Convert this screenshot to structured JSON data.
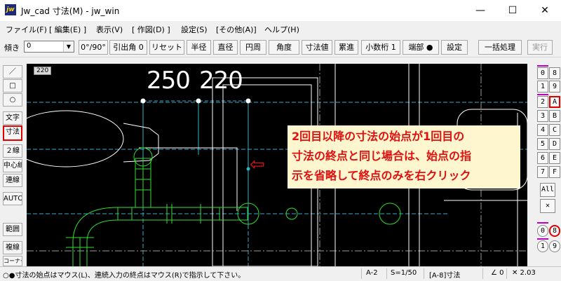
{
  "window": {
    "title": "Jw_cad 寸法(M) - jw_win",
    "icon_label": "jw",
    "controls": {
      "minimize": "—",
      "maximize": "☐",
      "close": "✕"
    }
  },
  "menu": [
    "ファイル(F)",
    "[ 編集(E) ]",
    "表示(V)",
    "[ 作図(D) ]",
    "設定(S)",
    "[その他(A)]",
    "ヘルプ(H)"
  ],
  "toolbar": {
    "angle_label": "傾き",
    "angle_value": "0",
    "buttons": [
      "0°/90°",
      "引出角 0",
      "リセット",
      "半径",
      "直径",
      "円周",
      "角度",
      "寸法値",
      "累進",
      "小数桁 1",
      "端部 ●",
      "設定",
      "一括処理"
    ],
    "run_label": "実行"
  },
  "left_toolbar": [
    "／",
    "□",
    "○",
    "文字",
    "寸法",
    "２線",
    "中心線",
    "連線",
    "AUTO",
    "範囲",
    "複線",
    "コーナー"
  ],
  "right_toolbar": {
    "rows": [
      [
        "0",
        "8"
      ],
      [
        "1",
        "9"
      ],
      [
        "2",
        "A"
      ],
      [
        "3",
        "B"
      ],
      [
        "4",
        "C"
      ],
      [
        "5",
        "D"
      ],
      [
        "6",
        "E"
      ],
      [
        "7",
        "F"
      ]
    ],
    "all_label": "All",
    "cross_label": "✕",
    "group_rows": [
      [
        "0",
        "8"
      ],
      [
        "1",
        "9"
      ]
    ]
  },
  "canvas": {
    "layer_label": "220",
    "dim_values": [
      "250",
      "220"
    ],
    "callout_lines": [
      "2回目以降の寸法の始点が1回目の",
      "寸法の終点と同じ場合は、始点の指",
      "示を省略して終点のみを右クリック"
    ],
    "arrow_symbol": "⇦",
    "colors": {
      "annotation": "#e01010",
      "highlight_border": "#e00000"
    }
  },
  "status": {
    "message": "○●寸法の始点はマウス(L)、連続入力の終点はマウス(R)で指示して下さい。",
    "paper": "A-2",
    "scale": "S=1/50",
    "layer": "[A-8]寸法",
    "angle": "∠ 0",
    "zoom": "✕ 2.03"
  }
}
